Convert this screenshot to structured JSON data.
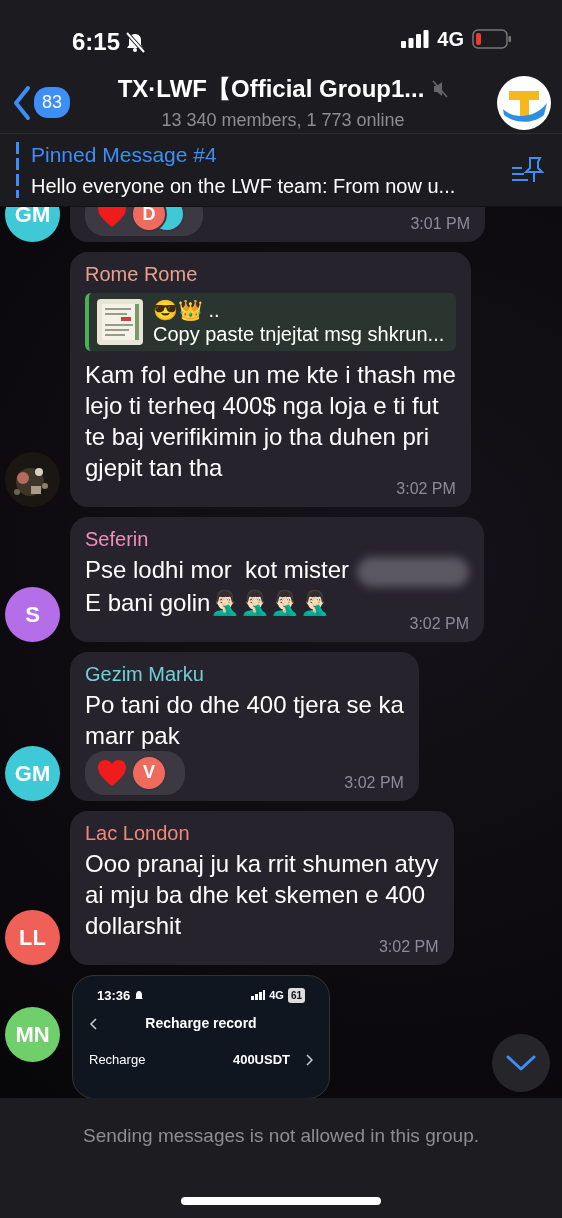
{
  "status_bar": {
    "time": "6:15",
    "silent": true,
    "network": "4G",
    "battery_low": true
  },
  "header": {
    "back_badge": "83",
    "title": "TX·LWF【Official Group1...",
    "muted": true,
    "subtitle": "13 340 members, 1 773 online"
  },
  "pinned": {
    "title": "Pinned Message #4",
    "text": "Hello everyone on the LWF team: From now u..."
  },
  "messages": [
    {
      "kind": "text",
      "avatar": {
        "kind": "initials",
        "initials": "GM",
        "color": "#3fc9d6"
      },
      "reactions": [
        {
          "kind": "heart"
        },
        {
          "kind": "avatar",
          "initials": "D",
          "color": "#ef6b5e"
        },
        {
          "kind": "avatar",
          "color": "#3fc9d6"
        }
      ],
      "time": "3:01 PM"
    },
    {
      "kind": "text",
      "sender": {
        "name": "Rome Rome",
        "color": "#e9a08a"
      },
      "reply": {
        "emoji": "😎👑 ..",
        "text": "Copy paste tnjejtat msg shkrun..."
      },
      "text": "Kam fol edhe un me kte i thash me\nlejo ti terheq 400$ nga loja e ti fut\nte baj verifikimin jo tha duhen pri\ngjepit tan tha",
      "time": "3:02 PM"
    },
    {
      "kind": "text",
      "sender": {
        "name": "Seferin",
        "color": "#ee8fbd"
      },
      "avatar": {
        "kind": "initials",
        "initials": "S",
        "color": "#b46ee8"
      },
      "lines": [
        {
          "text": "Pse lodhi mor  kot mister",
          "redacted": true
        },
        {
          "text": "E bani golin🤦🏻‍♂️🤦🏻‍♂️🤦🏻‍♂️🤦🏻‍♂️",
          "redacted": false
        }
      ],
      "time": "3:02 PM"
    },
    {
      "kind": "text",
      "sender": {
        "name": "Gezim Marku",
        "color": "#6fcfd9"
      },
      "avatar": {
        "kind": "initials",
        "initials": "GM",
        "color": "#3fc9d6"
      },
      "text": "Po tani do dhe 400 tjera se ka\nmarr pak",
      "reactions": [
        {
          "kind": "heart"
        },
        {
          "kind": "avatar",
          "initials": "V",
          "color": "#ef6b5e"
        }
      ],
      "time": "3:02 PM"
    },
    {
      "kind": "text",
      "sender": {
        "name": "Lac London",
        "color": "#f08877"
      },
      "avatar": {
        "kind": "initials",
        "initials": "LL",
        "color": "#ef6158"
      },
      "text": "Ooo pranaj ju ka rrit shumen atyy\nai mju ba dhe ket skemen e 400\ndollarshit",
      "time": "3:02 PM"
    },
    {
      "avatar": {
        "kind": "initials",
        "initials": "MN",
        "color": "#6fcf6a"
      },
      "screenshot": {
        "time": "13:36",
        "network": "4G",
        "battery": "61",
        "title": "Recharge record",
        "row_label": "Recharge",
        "row_amount": "400USDT"
      }
    }
  ],
  "footer": {
    "notice": "Sending messages is not allowed in this group."
  }
}
